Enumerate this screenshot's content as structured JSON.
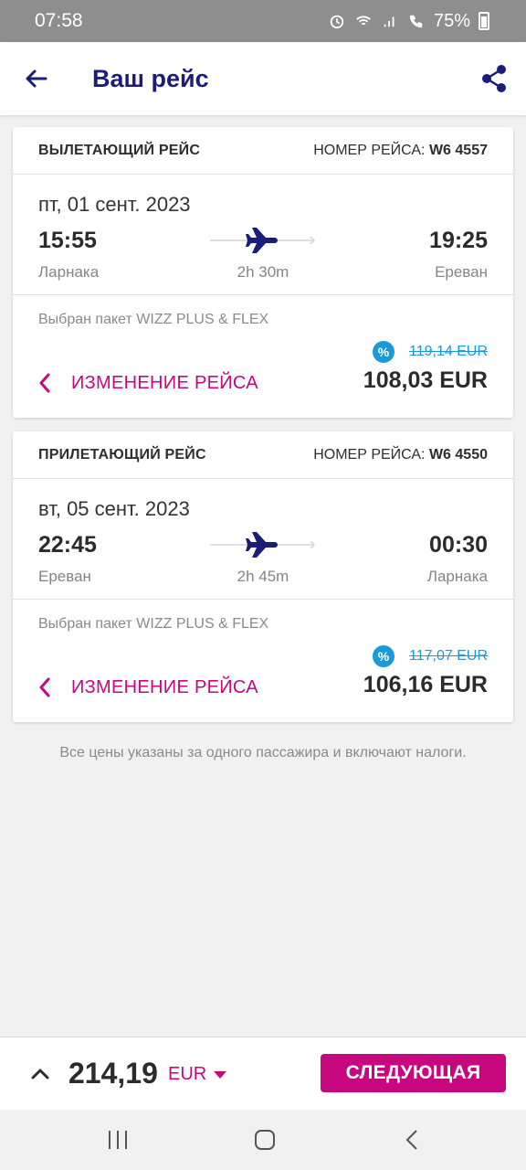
{
  "status_bar": {
    "time": "07:58",
    "battery": "75%"
  },
  "header": {
    "title": "Ваш рейс"
  },
  "flights": [
    {
      "heading": "ВЫЛЕТАЮЩИЙ РЕЙС",
      "flight_number_label": "НОМЕР РЕЙСА:",
      "flight_number": "W6 4557",
      "date": "пт, 01 сент. 2023",
      "departure_time": "15:55",
      "arrival_time": "19:25",
      "departure_city": "Ларнака",
      "arrival_city": "Ереван",
      "duration": "2h 30m",
      "package": "Выбран пакет WIZZ PLUS & FLEX",
      "old_price": "119,14 EUR",
      "price": "108,03 EUR",
      "change_label": "ИЗМЕНЕНИЕ РЕЙСА"
    },
    {
      "heading": "ПРИЛЕТАЮЩИЙ РЕЙС",
      "flight_number_label": "НОМЕР РЕЙСА:",
      "flight_number": "W6 4550",
      "date": "вт, 05 сент. 2023",
      "departure_time": "22:45",
      "arrival_time": "00:30",
      "departure_city": "Ереван",
      "arrival_city": "Ларнака",
      "duration": "2h 45m",
      "package": "Выбран пакет WIZZ PLUS & FLEX",
      "old_price": "117,07 EUR",
      "price": "106,16 EUR",
      "change_label": "ИЗМЕНЕНИЕ РЕЙСА"
    }
  ],
  "discount_symbol": "%",
  "note": "Все цены указаны за одного пассажира и включают налоги.",
  "footer": {
    "total": "214,19",
    "currency": "EUR",
    "next_label": "СЛЕДУЮЩАЯ"
  },
  "colors": {
    "brand_navy": "#1b1e78",
    "brand_magenta": "#c6077e",
    "discount_blue": "#1a9ad7"
  },
  "icons": [
    "back-arrow-icon",
    "share-icon",
    "airplane-icon",
    "discount-icon",
    "chevron-left-icon",
    "chevron-up-icon",
    "caret-down-icon",
    "recents-icon",
    "home-icon",
    "back-icon"
  ]
}
